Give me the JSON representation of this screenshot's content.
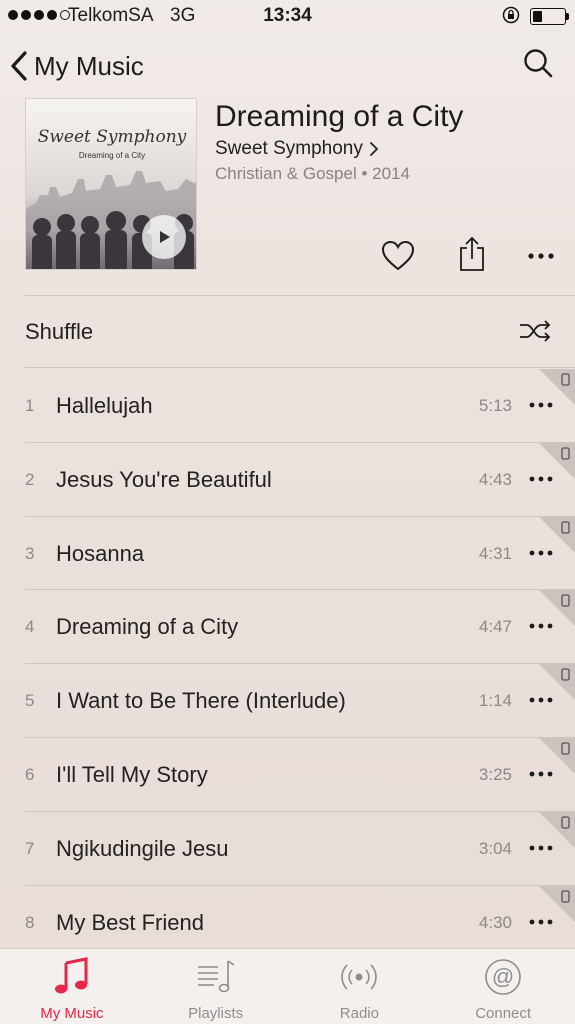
{
  "status_bar": {
    "carrier": "TelkomSA",
    "network": "3G",
    "time": "13:34",
    "signal_bars": 4,
    "battery_level": 0.3
  },
  "nav": {
    "back_label": "My Music",
    "back_icon": "chevron-left-icon",
    "search_icon": "search-icon"
  },
  "album": {
    "art_title": "Sweet Symphony",
    "art_subtitle": "Dreaming of a City",
    "title": "Dreaming of a City",
    "artist": "Sweet Symphony",
    "genre_year": "Christian & Gospel • 2014"
  },
  "actions": {
    "like_icon": "heart-icon",
    "share_icon": "share-icon",
    "more_icon": "more-icon"
  },
  "shuffle": {
    "label": "Shuffle",
    "icon": "shuffle-icon"
  },
  "tracks": [
    {
      "number": "1",
      "title": "Hallelujah",
      "duration": "5:13"
    },
    {
      "number": "2",
      "title": "Jesus You're Beautiful",
      "duration": "4:43"
    },
    {
      "number": "3",
      "title": "Hosanna",
      "duration": "4:31"
    },
    {
      "number": "4",
      "title": "Dreaming of a City",
      "duration": "4:47"
    },
    {
      "number": "5",
      "title": "I Want to Be There (Interlude)",
      "duration": "1:14"
    },
    {
      "number": "6",
      "title": "I'll Tell My Story",
      "duration": "3:25"
    },
    {
      "number": "7",
      "title": "Ngikudingile Jesu",
      "duration": "3:04"
    },
    {
      "number": "8",
      "title": "My Best Friend",
      "duration": "4:30"
    }
  ],
  "tab_bar": {
    "tabs": [
      {
        "label": "My Music",
        "icon": "music-note-icon",
        "active": true
      },
      {
        "label": "Playlists",
        "icon": "playlists-icon",
        "active": false
      },
      {
        "label": "Radio",
        "icon": "radio-icon",
        "active": false
      },
      {
        "label": "Connect",
        "icon": "at-sign-icon",
        "active": false
      }
    ]
  },
  "colors": {
    "accent": "#e7274a",
    "text": "#1c1c1c",
    "secondary_text": "#8f8884",
    "background": "#ece3de"
  }
}
